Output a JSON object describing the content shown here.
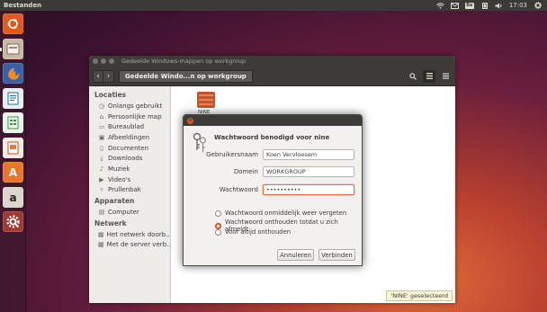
{
  "top_panel": {
    "app_name": "Bestanden",
    "keyboard_layout": "Be",
    "time": "17:03",
    "indicators": [
      "network-icon",
      "mail-icon",
      "keyboard-icon",
      "battery-icon",
      "volume-icon",
      "session-gear-icon"
    ]
  },
  "launcher": {
    "items": [
      {
        "name": "ubuntu-dash-icon",
        "color": "#e05a1f"
      },
      {
        "name": "files-icon",
        "color": "#b4a48e"
      },
      {
        "name": "firefox-icon",
        "color": "#e66000"
      },
      {
        "name": "writer-icon",
        "color": "#1c6cb4"
      },
      {
        "name": "calc-icon",
        "color": "#2e9a36"
      },
      {
        "name": "impress-icon",
        "color": "#c7511c"
      },
      {
        "name": "software-center-icon",
        "color": "#e8772b"
      },
      {
        "name": "amazon-icon",
        "color": "#d9d4cb"
      },
      {
        "name": "system-settings-icon",
        "color": "#c0342a"
      }
    ]
  },
  "nautilus": {
    "window_title": "Gedeelde Windows-mappen op workgroup",
    "breadcrumb": "Gedeelde Windo...n op workgroup",
    "sidebar": {
      "sections": [
        {
          "heading": "Locaties",
          "items": [
            {
              "label": "Onlangs gebruikt",
              "icon": "clock-icon"
            },
            {
              "label": "Persoonlijke map",
              "icon": "home-icon"
            },
            {
              "label": "Bureaublad",
              "icon": "desktop-icon"
            },
            {
              "label": "Afbeeldingen",
              "icon": "pictures-icon"
            },
            {
              "label": "Documenten",
              "icon": "documents-icon"
            },
            {
              "label": "Downloads",
              "icon": "downloads-icon"
            },
            {
              "label": "Muziek",
              "icon": "music-icon"
            },
            {
              "label": "Video's",
              "icon": "videos-icon"
            },
            {
              "label": "Prullenbak",
              "icon": "trash-icon"
            }
          ]
        },
        {
          "heading": "Apparaten",
          "items": [
            {
              "label": "Computer",
              "icon": "computer-icon"
            }
          ]
        },
        {
          "heading": "Netwerk",
          "items": [
            {
              "label": "Het netwerk doorb...",
              "icon": "network-icon"
            },
            {
              "label": "Met de server verb...",
              "icon": "server-icon"
            }
          ]
        }
      ]
    },
    "file_item": {
      "label": "NINE"
    },
    "status": "'NINE' geselecteerd"
  },
  "dialog": {
    "heading": "Wachtwoord benodigd voor nine",
    "username_label": "Gebruikersnaam",
    "username_value": "Koen Vervloesem",
    "domain_label": "Domein",
    "domain_value": "WORKGROUP",
    "password_label": "Wachtwoord",
    "password_value": "••••••••••",
    "radio_options": [
      {
        "label": "Wachtwoord onmiddelijk weer vergeten",
        "checked": false
      },
      {
        "label": "Wachtwoord onthouden totdat u zich afmeldt",
        "checked": true
      },
      {
        "label": "Voor altijd onthouden",
        "checked": false
      }
    ],
    "cancel_label": "Annuleren",
    "connect_label": "Verbinden"
  }
}
